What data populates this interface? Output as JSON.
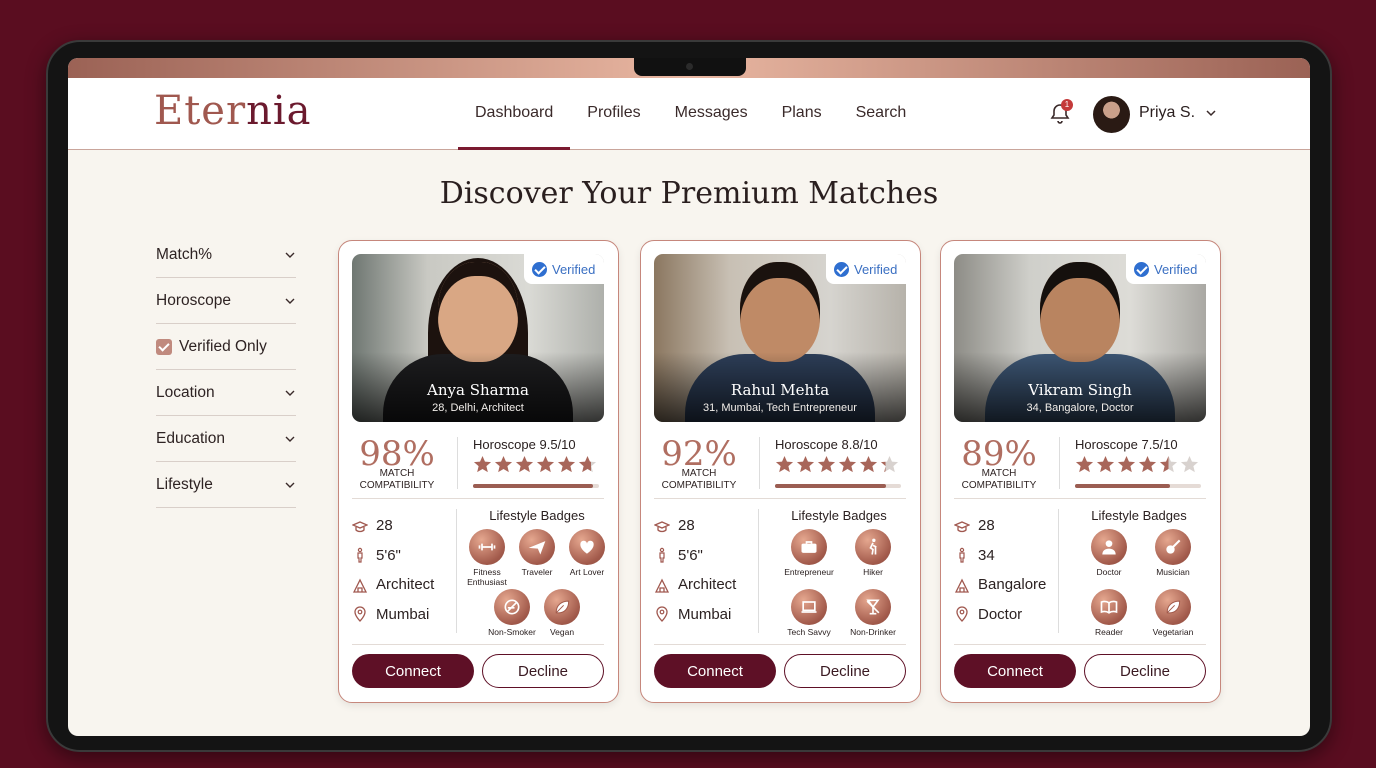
{
  "app": {
    "logo_prefix": "Eter",
    "logo_suffix": "nia",
    "accent": "#5e1026",
    "rose": "#b06e61"
  },
  "nav": {
    "items": [
      {
        "label": "Dashboard",
        "active": true
      },
      {
        "label": "Profiles"
      },
      {
        "label": "Messages"
      },
      {
        "label": "Plans"
      },
      {
        "label": "Search"
      }
    ]
  },
  "user": {
    "name": "Priya S.",
    "notifications": "1"
  },
  "page": {
    "title": "Discover Your Premium Matches"
  },
  "filters": {
    "match": "Match%",
    "horoscope": "Horoscope",
    "verified": "Verified Only",
    "location": "Location",
    "education": "Education",
    "lifestyle": "Lifestyle"
  },
  "labels": {
    "verified": "Verified",
    "match_line1": "MATCH",
    "match_line2": "COMPATIBILITY",
    "lifestyle_title": "Lifestyle Badges",
    "connect": "Connect",
    "decline": "Decline"
  },
  "profiles": [
    {
      "name": "Anya Sharma",
      "subtitle": "28, Delhi, Architect",
      "match": "98%",
      "horoscope": "Horoscope 9.5/10",
      "rating": 9.5,
      "facts": {
        "age": "28",
        "height": "5'6\"",
        "profession": "Architect",
        "city": "Mumbai"
      },
      "badges": [
        {
          "label": "Fitness Enthusiast",
          "icon": "dumbbell-icon"
        },
        {
          "label": "Traveler",
          "icon": "plane-icon"
        },
        {
          "label": "Art Lover",
          "icon": "heart-icon"
        },
        {
          "label": "Non-Smoker",
          "icon": "no-smoking-icon"
        },
        {
          "label": "Vegan",
          "icon": "leaf-icon"
        }
      ]
    },
    {
      "name": "Rahul Mehta",
      "subtitle": "31, Mumbai, Tech Entrepreneur",
      "match": "92%",
      "horoscope": "Horoscope 8.8/10",
      "rating": 8.8,
      "facts": {
        "age": "28",
        "height": "5'6\"",
        "profession": "Architect",
        "city": "Mumbai"
      },
      "badges": [
        {
          "label": "Entrepreneur",
          "icon": "briefcase-icon"
        },
        {
          "label": "Hiker",
          "icon": "hiker-icon"
        },
        {
          "label": "Tech Savvy",
          "icon": "laptop-icon"
        },
        {
          "label": "Non-Drinker",
          "icon": "no-drink-icon"
        }
      ]
    },
    {
      "name": "Vikram Singh",
      "subtitle": "34, Bangalore, Doctor",
      "match": "89%",
      "horoscope": "Horoscope 7.5/10",
      "rating": 7.5,
      "facts": {
        "age": "28",
        "height": "34",
        "profession": "Bangalore",
        "city": "Doctor"
      },
      "badges": [
        {
          "label": "Doctor",
          "icon": "doctor-icon"
        },
        {
          "label": "Musician",
          "icon": "guitar-icon"
        },
        {
          "label": "Reader",
          "icon": "book-icon"
        },
        {
          "label": "Vegetarian",
          "icon": "leaf-icon"
        }
      ]
    }
  ]
}
